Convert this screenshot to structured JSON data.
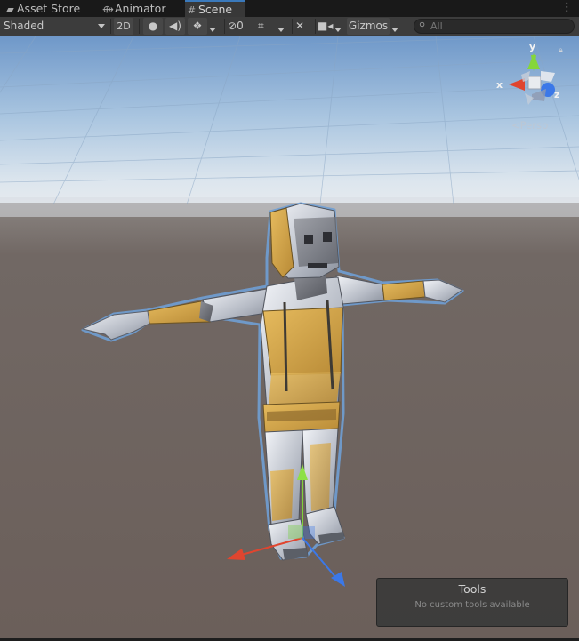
{
  "tabs": [
    {
      "label": "Asset Store",
      "icon": "shopping-bag-icon"
    },
    {
      "label": "Animator",
      "icon": "animator-icon"
    },
    {
      "label": "Scene",
      "icon": "grid-icon",
      "active": true
    }
  ],
  "toolbar": {
    "draw_mode": "Shaded",
    "mode_2d": "2D",
    "hidden_count": "0",
    "gizmos": "Gizmos",
    "search_placeholder": "All"
  },
  "orientation": {
    "x": "x",
    "y": "y",
    "z": "z",
    "projection": "Persp"
  },
  "tools_overlay": {
    "title": "Tools",
    "message": "No custom tools available"
  },
  "colors": {
    "axis_x": "#e0452f",
    "axis_y": "#85d73a",
    "axis_z": "#3b78e8",
    "selection": "#5b8fc9"
  }
}
